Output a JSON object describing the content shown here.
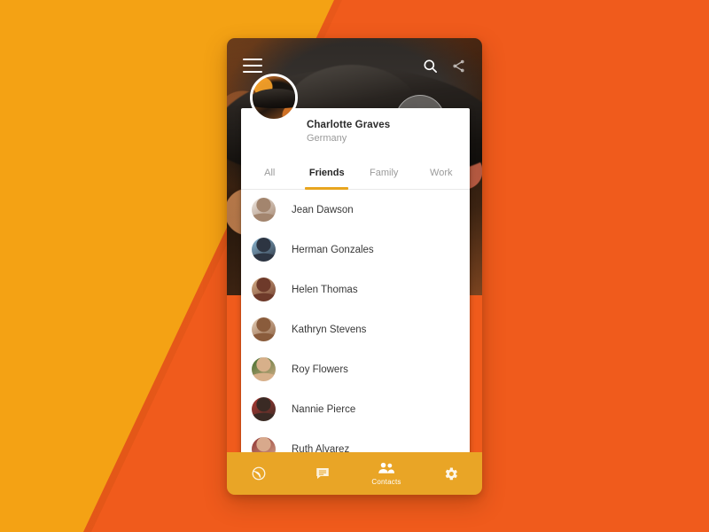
{
  "theme": {
    "bg_yellow": "#F4A214",
    "bg_orange": "#F05B1C",
    "nav_bar": "#E9A526",
    "tab_indicator": "#E8A51E",
    "card_bg": "#FFFFFF"
  },
  "appbar": {
    "menu_icon": "hamburger-menu-icon",
    "search_icon": "search-icon",
    "more_icon": "share-icon"
  },
  "profile": {
    "name": "Charlotte Graves",
    "location": "Germany",
    "avatar_icon": "profile-avatar"
  },
  "tabs": [
    {
      "label": "All",
      "active": false
    },
    {
      "label": "Friends",
      "active": true
    },
    {
      "label": "Family",
      "active": false
    },
    {
      "label": "Work",
      "active": false
    }
  ],
  "contacts": [
    {
      "name": "Jean Dawson",
      "avatar_bg": "#efe9e4",
      "avatar_fg": "#a3856e"
    },
    {
      "name": "Herman Gonzales",
      "avatar_bg": "#8fbcd8",
      "avatar_fg": "#2d3542"
    },
    {
      "name": "Helen Thomas",
      "avatar_bg": "#d9b48c",
      "avatar_fg": "#6e3a2a"
    },
    {
      "name": "Kathryn Stevens",
      "avatar_bg": "#e7d2bb",
      "avatar_fg": "#8a5c3c"
    },
    {
      "name": "Roy Flowers",
      "avatar_bg": "#3f6b2a",
      "avatar_fg": "#d7b08a"
    },
    {
      "name": "Nannie Pierce",
      "avatar_bg": "#b23a34",
      "avatar_fg": "#3a2a24"
    },
    {
      "name": "Ruth Alvarez",
      "avatar_bg": "#8c2f30",
      "avatar_fg": "#d8a98c"
    }
  ],
  "bottom_nav": [
    {
      "label": "",
      "icon": "globe-icon",
      "active": false
    },
    {
      "label": "",
      "icon": "chat-icon",
      "active": false
    },
    {
      "label": "Contacts",
      "icon": "people-icon",
      "active": true
    },
    {
      "label": "",
      "icon": "gear-icon",
      "active": false
    }
  ]
}
